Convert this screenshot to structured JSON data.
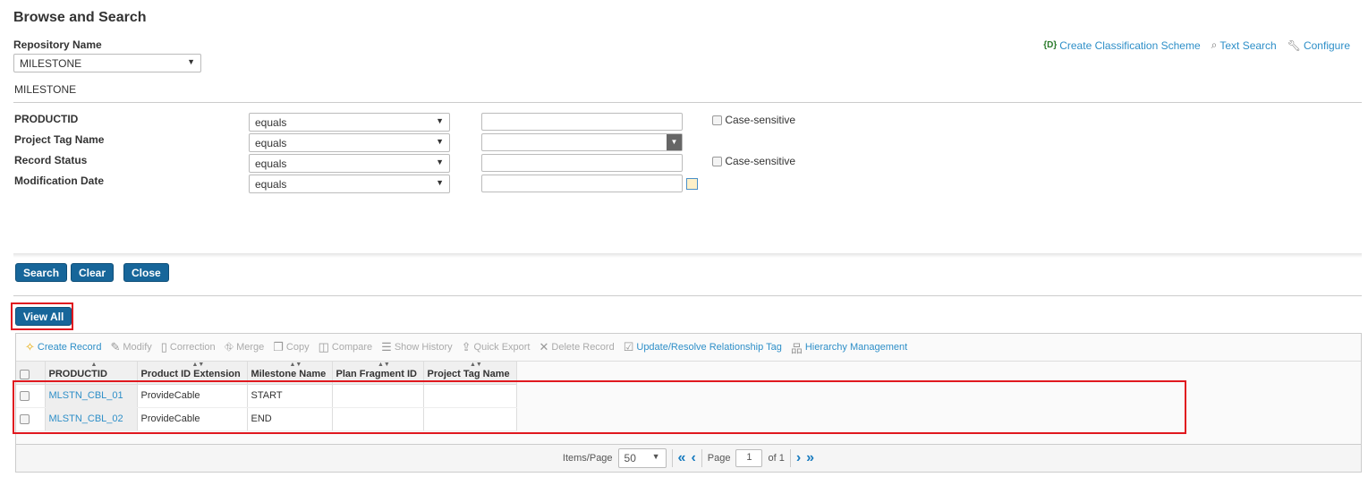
{
  "title": "Browse and Search",
  "repo": {
    "label": "Repository Name",
    "value": "MILESTONE",
    "subtitle": "MILESTONE"
  },
  "top_links": [
    {
      "label": "Create Classification Scheme",
      "icon": "classification-icon"
    },
    {
      "label": "Text Search",
      "icon": "text-search-icon"
    },
    {
      "label": "Configure",
      "icon": "wrench-icon"
    }
  ],
  "criteria": [
    {
      "label": "PRODUCTID",
      "operator": "equals",
      "value": "",
      "case_sensitive": "Case-sensitive"
    },
    {
      "label": "Project Tag Name",
      "operator": "equals",
      "value": ""
    },
    {
      "label": "Record Status",
      "operator": "equals",
      "value": "",
      "case_sensitive": "Case-sensitive"
    },
    {
      "label": "Modification Date",
      "operator": "equals",
      "value": ""
    }
  ],
  "buttons": {
    "search": "Search",
    "clear": "Clear",
    "close": "Close",
    "view_all": "View All"
  },
  "toolbar": [
    {
      "label": "Create Record",
      "enabled": true
    },
    {
      "label": "Modify",
      "enabled": false
    },
    {
      "label": "Correction",
      "enabled": false
    },
    {
      "label": "Merge",
      "enabled": false
    },
    {
      "label": "Copy",
      "enabled": false
    },
    {
      "label": "Compare",
      "enabled": false
    },
    {
      "label": "Show History",
      "enabled": false
    },
    {
      "label": "Quick Export",
      "enabled": false
    },
    {
      "label": "Delete Record",
      "enabled": false
    },
    {
      "label": "Update/Resolve Relationship Tag",
      "enabled": true
    },
    {
      "label": "Hierarchy Management",
      "enabled": true
    }
  ],
  "columns": [
    "PRODUCTID",
    "Product ID Extension",
    "Milestone Name",
    "Plan Fragment ID",
    "Project Tag Name"
  ],
  "rows": [
    [
      "MLSTN_CBL_01",
      "ProvideCable",
      "START",
      "",
      ""
    ],
    [
      "MLSTN_CBL_02",
      "ProvideCable",
      "END",
      "",
      ""
    ]
  ],
  "pager": {
    "items_label": "Items/Page",
    "items_value": "50",
    "page_label": "Page",
    "page": "1",
    "of": "of 1"
  }
}
